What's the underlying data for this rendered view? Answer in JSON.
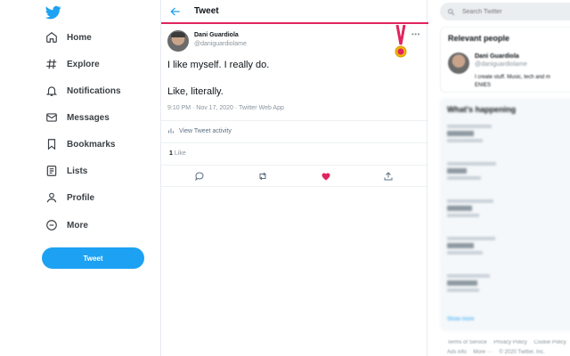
{
  "nav": {
    "items": [
      {
        "label": "Home",
        "icon": "home-icon"
      },
      {
        "label": "Explore",
        "icon": "hashtag-icon"
      },
      {
        "label": "Notifications",
        "icon": "bell-icon"
      },
      {
        "label": "Messages",
        "icon": "envelope-icon"
      },
      {
        "label": "Bookmarks",
        "icon": "bookmark-icon"
      },
      {
        "label": "Lists",
        "icon": "list-icon"
      },
      {
        "label": "Profile",
        "icon": "person-icon"
      },
      {
        "label": "More",
        "icon": "more-circle-icon"
      }
    ],
    "tweet_button": "Tweet"
  },
  "header": {
    "title": "Tweet"
  },
  "tweet": {
    "author_name": "Dani Guardiola",
    "author_handle": "@daniguardiolame",
    "more": "•••",
    "line1": "I like myself. I really do.",
    "line2": "Like, literally.",
    "meta": "9:10 PM · Nov 17, 2020 · Twitter Web App",
    "activity": "View Tweet activity",
    "like_count": "1",
    "like_word": "Like"
  },
  "right": {
    "search_placeholder": "Search Twitter",
    "relevant_title": "Relevant people",
    "person_name": "Dani Guardiola",
    "person_handle": "@daniguardiolame",
    "person_bio": "I create stuff. Music, tech and m",
    "person_bio2": "ENIES",
    "happening_title": "What's happening",
    "show_more": "Show more",
    "footer_links": [
      "Terms of Service",
      "Privacy Policy",
      "Cookie Policy"
    ],
    "footer_links2": [
      "Ads info",
      "More ···",
      "© 2020 Twitter, Inc."
    ]
  },
  "colors": {
    "accent": "#1da1f2",
    "like": "#e0245e"
  }
}
